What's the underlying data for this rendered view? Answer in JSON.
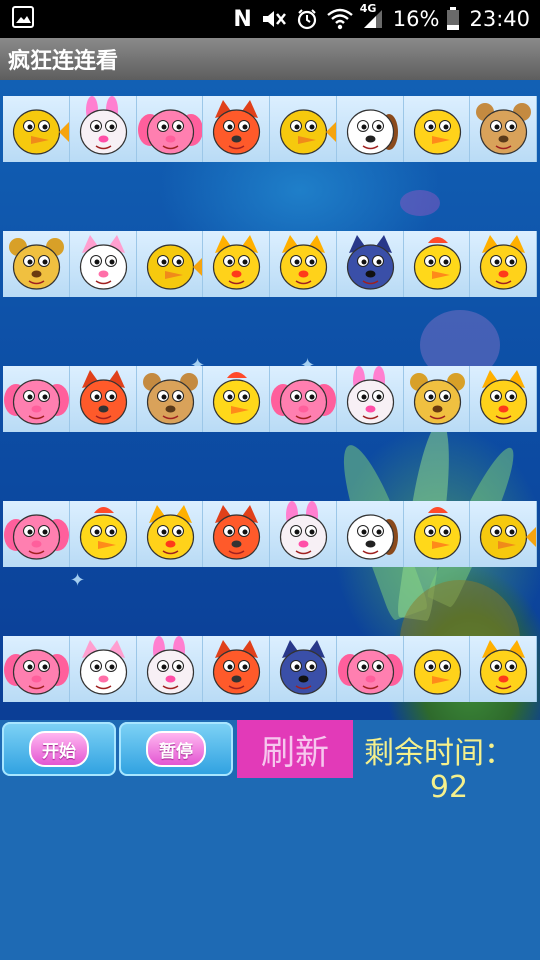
{
  "status_bar": {
    "nfc": "N",
    "network": "4G",
    "battery": "16%",
    "time": "23:40"
  },
  "app": {
    "title": "疯狂连连看"
  },
  "board": {
    "rows": [
      [
        "fish",
        "rabbit",
        "elephant",
        "fox",
        "fish",
        "dog",
        "duck",
        "bear"
      ],
      [
        "lion",
        "cat",
        "fish",
        "tiger",
        "tiger",
        "wolf",
        "chick",
        "tiger"
      ],
      [
        "elephant",
        "fox",
        "bear",
        "chick",
        "elephant",
        "rabbit",
        "lion",
        "tiger"
      ],
      [
        "elephant",
        "chick",
        "tiger",
        "fox",
        "rabbit",
        "dog",
        "chick",
        "fish"
      ],
      [
        "elephant",
        "cat",
        "rabbit",
        "fox",
        "wolf",
        "elephant",
        "duck",
        "tiger"
      ]
    ]
  },
  "controls": {
    "start_label": "开始",
    "pause_label": "暂停",
    "refresh_label": "刷新",
    "time_label": "剩余时间：",
    "time_value": "92"
  },
  "colors": {
    "background": "#1e6ab4",
    "refresh_button": "#e23ab8",
    "timer_text": "#f5f08c"
  }
}
